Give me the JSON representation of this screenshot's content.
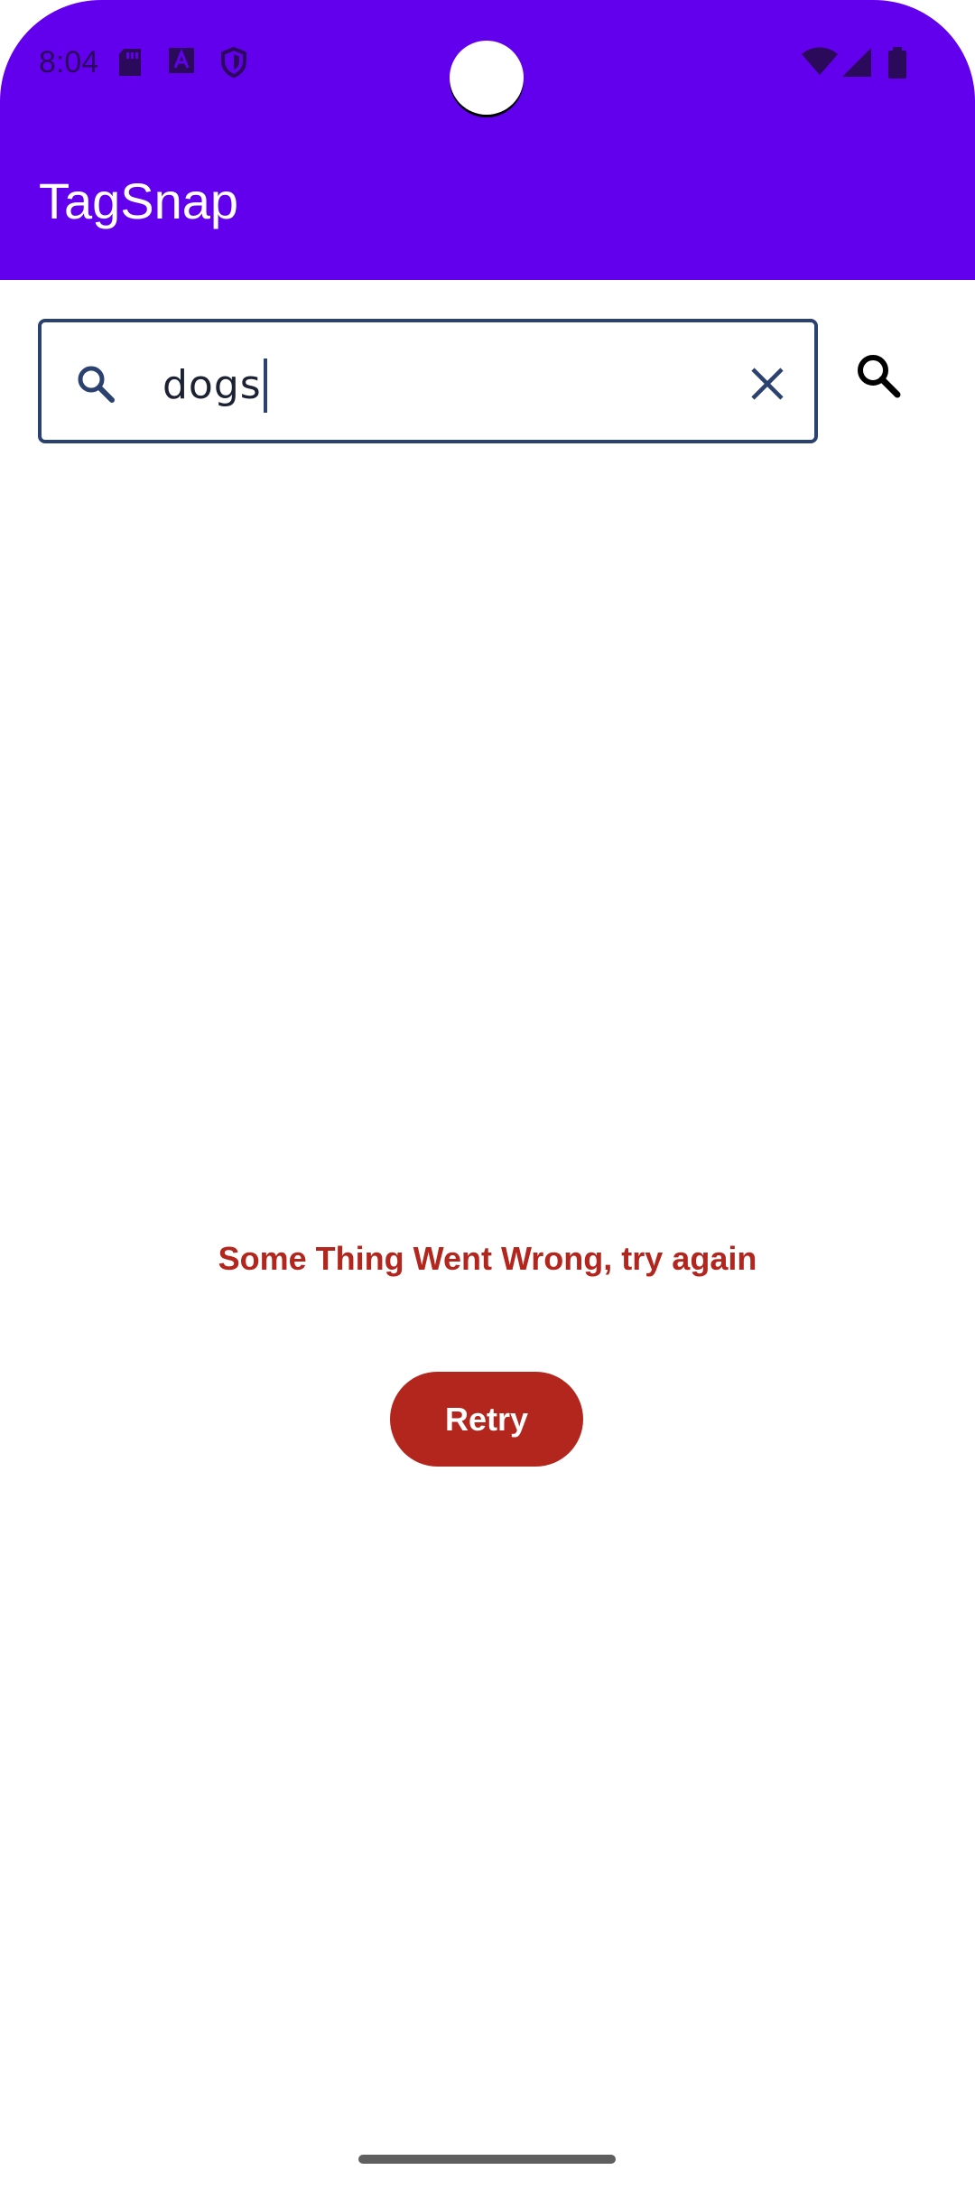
{
  "status_bar": {
    "time": "8:04",
    "left_icons": [
      "sd-card-icon",
      "text-format-icon",
      "shield-icon"
    ],
    "right_icons": [
      "wifi-icon",
      "signal-icon",
      "battery-icon"
    ]
  },
  "app_bar": {
    "title": "TagSnap",
    "background_color": "#6200ee"
  },
  "search": {
    "value": "dogs",
    "leading_icon": "search-icon",
    "clear_icon": "close-icon",
    "border_color": "#2b4170"
  },
  "search_action": {
    "icon": "search-icon"
  },
  "error": {
    "message": "Some Thing Went Wrong, try again",
    "color": "#b3261e"
  },
  "retry": {
    "label": "Retry",
    "color": "#b3261e"
  }
}
